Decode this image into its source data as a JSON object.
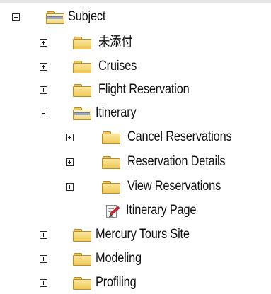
{
  "tree": {
    "nodes": [
      {
        "label": "Subject",
        "toggle": "collapse",
        "icon": "folder-open-icon"
      },
      {
        "label": "未添付",
        "toggle": "expand",
        "icon": "folder-icon"
      },
      {
        "label": "Cruises",
        "toggle": "expand",
        "icon": "folder-icon"
      },
      {
        "label": "Flight Reservation",
        "toggle": "expand",
        "icon": "folder-icon"
      },
      {
        "label": "Itinerary",
        "toggle": "collapse",
        "icon": "folder-open-icon"
      },
      {
        "label": "Cancel Reservations",
        "toggle": "expand",
        "icon": "folder-icon"
      },
      {
        "label": "Reservation Details",
        "toggle": "expand",
        "icon": "folder-icon"
      },
      {
        "label": "View Reservations",
        "toggle": "expand",
        "icon": "folder-icon"
      },
      {
        "label": "Itinerary Page",
        "toggle": "none",
        "icon": "test-page-icon"
      },
      {
        "label": "Mercury Tours Site",
        "toggle": "expand",
        "icon": "folder-icon"
      },
      {
        "label": "Modeling",
        "toggle": "expand",
        "icon": "folder-icon"
      },
      {
        "label": "Profiling",
        "toggle": "expand",
        "icon": "folder-icon"
      }
    ]
  }
}
